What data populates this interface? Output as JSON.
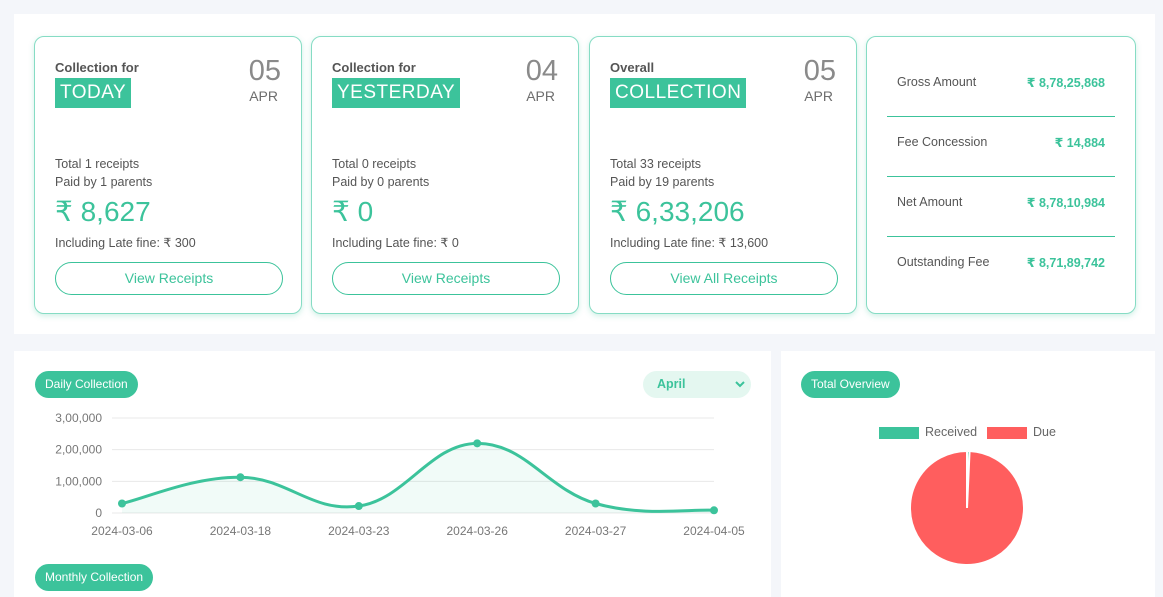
{
  "cards": [
    {
      "label_top": "Collection for",
      "tag": "TODAY",
      "day": "05",
      "month": "APR",
      "receipts": "Total 1 receipts",
      "parents": "Paid by 1 parents",
      "amount": "₹ 8,627",
      "late_fine": "Including Late fine: ₹ 300",
      "button": "View Receipts"
    },
    {
      "label_top": "Collection for",
      "tag": "YESTERDAY",
      "day": "04",
      "month": "APR",
      "receipts": "Total 0 receipts",
      "parents": "Paid by 0 parents",
      "amount": "₹ 0",
      "late_fine": "Including Late fine: ₹ 0",
      "button": "View Receipts"
    },
    {
      "label_top": "Overall",
      "tag": "COLLECTION",
      "day": "05",
      "month": "APR",
      "receipts": "Total 33 receipts",
      "parents": "Paid by 19 parents",
      "amount": "₹ 6,33,206",
      "late_fine": "Including Late fine: ₹ 13,600",
      "button": "View All Receipts"
    }
  ],
  "summary": [
    {
      "label": "Gross Amount",
      "value": "₹ 8,78,25,868"
    },
    {
      "label": "Fee Concession",
      "value": "₹ 14,884"
    },
    {
      "label": "Net Amount",
      "value": "₹ 8,78,10,984"
    },
    {
      "label": "Outstanding Fee",
      "value": "₹ 8,71,89,742"
    }
  ],
  "daily": {
    "title": "Daily Collection",
    "month_selected": "April",
    "chevron_icon": "chevron-down-icon"
  },
  "monthly": {
    "title": "Monthly Collection"
  },
  "overview": {
    "title": "Total Overview"
  },
  "colors": {
    "accent": "#3cc39b",
    "due": "#ff5e5e",
    "grid": "#e8e8e8"
  },
  "chart_data": [
    {
      "type": "line",
      "x": [
        "2024-03-06",
        "2024-03-18",
        "2024-03-23",
        "2024-03-26",
        "2024-03-27",
        "2024-04-05"
      ],
      "series": [
        {
          "values": [
            30000,
            113000,
            22000,
            220000,
            30000,
            8627
          ]
        }
      ],
      "yticks": [
        "0",
        "1,00,000",
        "2,00,000",
        "3,00,000"
      ],
      "ylim": [
        0,
        300000
      ],
      "grid": true,
      "fill": true
    },
    {
      "type": "pie",
      "labels": [
        "Received",
        "Due"
      ],
      "values": [
        633206,
        87189742
      ],
      "colors": [
        "#3cc39b",
        "#ff5e5e"
      ],
      "legend": "top"
    }
  ]
}
